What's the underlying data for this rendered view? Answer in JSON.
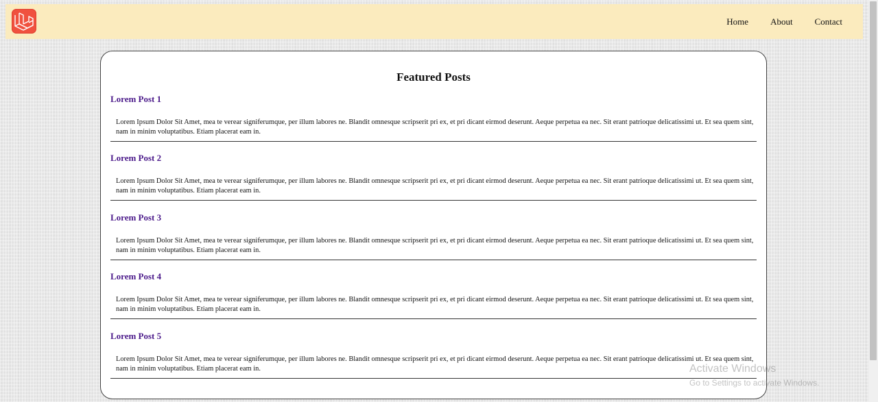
{
  "navbar": {
    "logo": {
      "icon": "laravel-logo-icon",
      "color": "#f0513f"
    },
    "links": [
      "Home",
      "About",
      "Contact"
    ],
    "background": "#fbebbe"
  },
  "main": {
    "title": "Featured Posts",
    "posts": [
      {
        "title": "Lorem Post 1",
        "body": "Lorem Ipsum Dolor Sit Amet, mea te verear signiferumque, per illum labores ne. Blandit omnesque scripserit pri ex, et pri dicant eirmod deserunt. Aeque perpetua ea nec. Sit erant patrioque delicatissimi ut. Et sea quem sint, nam in minim voluptatibus. Etiam placerat eam in."
      },
      {
        "title": "Lorem Post 2",
        "body": "Lorem Ipsum Dolor Sit Amet, mea te verear signiferumque, per illum labores ne. Blandit omnesque scripserit pri ex, et pri dicant eirmod deserunt. Aeque perpetua ea nec. Sit erant patrioque delicatissimi ut. Et sea quem sint, nam in minim voluptatibus. Etiam placerat eam in."
      },
      {
        "title": "Lorem Post 3",
        "body": "Lorem Ipsum Dolor Sit Amet, mea te verear signiferumque, per illum labores ne. Blandit omnesque scripserit pri ex, et pri dicant eirmod deserunt. Aeque perpetua ea nec. Sit erant patrioque delicatissimi ut. Et sea quem sint, nam in minim voluptatibus. Etiam placerat eam in."
      },
      {
        "title": "Lorem Post 4",
        "body": "Lorem Ipsum Dolor Sit Amet, mea te verear signiferumque, per illum labores ne. Blandit omnesque scripserit pri ex, et pri dicant eirmod deserunt. Aeque perpetua ea nec. Sit erant patrioque delicatissimi ut. Et sea quem sint, nam in minim voluptatibus. Etiam placerat eam in."
      },
      {
        "title": "Lorem Post 5",
        "body": "Lorem Ipsum Dolor Sit Amet, mea te verear signiferumque, per illum labores ne. Blandit omnesque scripserit pri ex, et pri dicant eirmod deserunt. Aeque perpetua ea nec. Sit erant patrioque delicatissimi ut. Et sea quem sint, nam in minim voluptatibus. Etiam placerat eam in."
      }
    ],
    "title_color": "#4b1a8a"
  },
  "watermark": {
    "title": "Activate Windows",
    "subtitle": "Go to Settings to activate Windows."
  }
}
